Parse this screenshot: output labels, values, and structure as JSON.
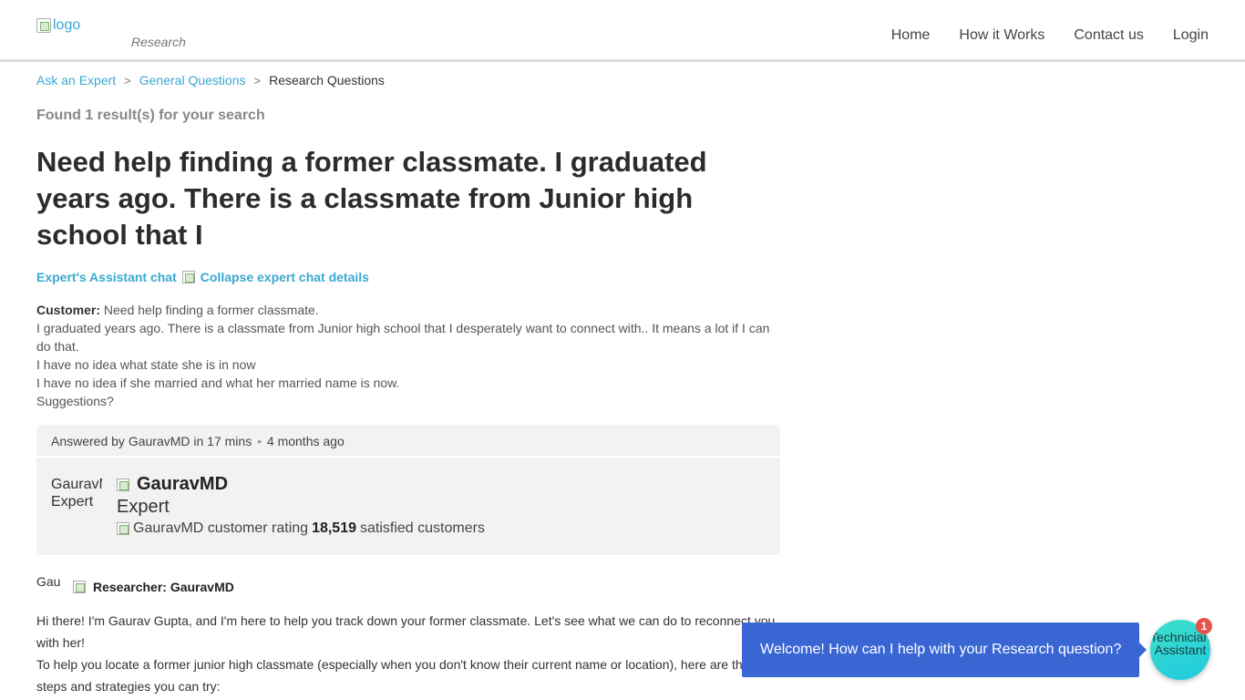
{
  "header": {
    "logo_alt": "logo",
    "section": "Research",
    "nav": [
      {
        "label": "Home"
      },
      {
        "label": "How it Works"
      },
      {
        "label": "Contact us"
      },
      {
        "label": "Login"
      }
    ]
  },
  "breadcrumb": {
    "items": [
      "Ask an Expert",
      "General Questions"
    ],
    "current": "Research Questions",
    "separator": ">"
  },
  "found_text": "Found 1 result(s) for your search",
  "question_title": "Need help finding a former classmate. I graduated years ago. There is a classmate from Junior high school that I",
  "chat_label": "Expert's Assistant chat",
  "collapse_alt": "Collapse expert chat details",
  "customer": {
    "label": "Customer:",
    "lines": [
      "Need help finding a former classmate.",
      "I graduated years ago. There is a classmate from Junior high school that I desperately want to connect with.. It means a lot if I can do that.",
      "I have no idea what state she is in now",
      "I have no idea if she married and what her married name is now.",
      "Suggestions?"
    ]
  },
  "answer_card": {
    "answered_by": "Answered by GauravMD in 17 mins",
    "bullet": "•",
    "time_ago": "4 months ago",
    "avatar_alt": "GauravMD Expert",
    "expert_name": "GauravMD",
    "expert_role": "Expert",
    "rating_alt": "GauravMD customer rating",
    "satisfied_count": "18,519",
    "satisfied_label": "satisfied customers"
  },
  "researcher": {
    "avatar_alt": "Gau",
    "label": "Researcher: GauravMD"
  },
  "answer_lines": [
    "Hi there! I'm Gaurav Gupta, and I'm here to help you track down your former classmate. Let's see what we can do to reconnect you with her!",
    "To help you locate a former junior high classmate (especially when you don't know their current name or location), here are the steps and strategies you can try:"
  ],
  "chat_widget": {
    "welcome": "Welcome! How can I help with your Research question?",
    "button_alt": "Technician Assistant",
    "badge": "1",
    "colors": {
      "welcome_bg": "#3a66d4",
      "button_bg": "#2ed6d4",
      "badge_bg": "#e6534a"
    }
  },
  "colors": {
    "link": "#3aa8d0",
    "card_bg": "#f2f2f2"
  }
}
